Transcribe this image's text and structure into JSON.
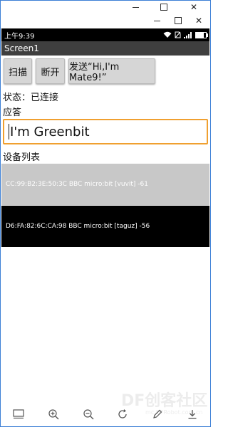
{
  "status_bar": {
    "time": "上午9:39",
    "battery_level": 0.8
  },
  "app": {
    "title": "Screen1"
  },
  "buttons": {
    "scan": "扫描",
    "disconnect": "断开",
    "send": "发送“Hi,I'm Mate9!”"
  },
  "status": {
    "text": "状态：已连接"
  },
  "response": {
    "label": "应答",
    "value": "I'm Greenbit"
  },
  "devices": {
    "label": "设备列表",
    "items": [
      "CC:99:B2:3E:50:3C BBC micro:bit [vuvit] -61",
      "D6:FA:82:6C:CA:98 BBC micro:bit [taguz] -56"
    ]
  },
  "watermark": {
    "text": "DF创客社区",
    "url": "mc.DFRobot.com.cn"
  },
  "colors": {
    "window_border": "#3c7fd6",
    "app_bar": "#3f3f3f",
    "input_focus": "#f0a030",
    "row_1": "#c8c8c8",
    "row_2": "#000000"
  },
  "icons": {
    "bottom_bar": [
      "panel-icon",
      "zoom-in-icon",
      "zoom-out-icon",
      "rotate-icon",
      "pen-icon",
      "download-icon"
    ]
  }
}
